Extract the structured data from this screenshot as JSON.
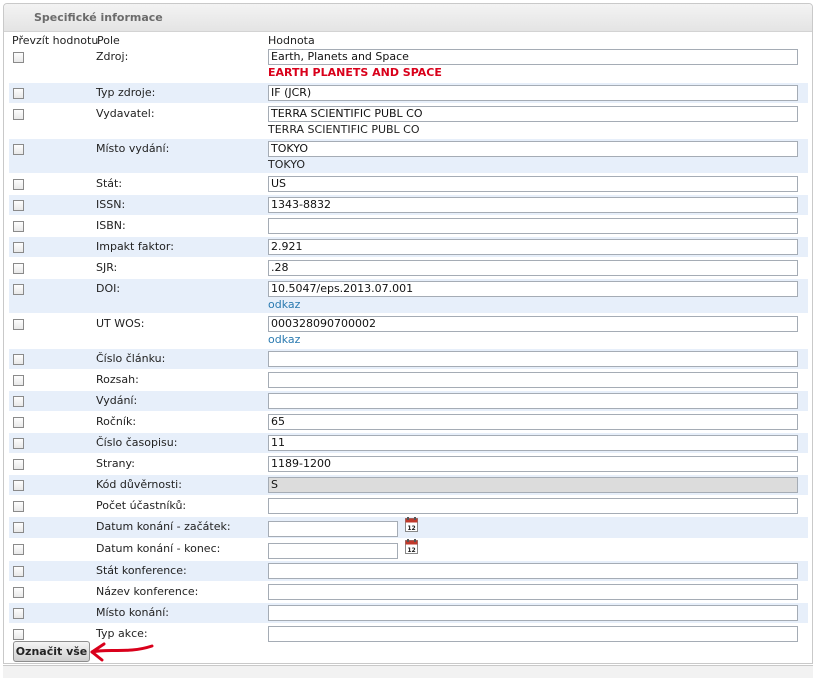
{
  "panel": {
    "title": "Specifické informace"
  },
  "columns": {
    "take": "Převzít hodnotu",
    "field": "Pole",
    "value": "Hodnota"
  },
  "rows": [
    {
      "label": "Zdroj:",
      "value": "Earth, Planets and Space",
      "sub": "EARTH PLANETS AND SPACE",
      "sub_style": "red"
    },
    {
      "label": "Typ zdroje:",
      "value": "IF (JCR)"
    },
    {
      "label": "Vydavatel:",
      "value": "TERRA SCIENTIFIC PUBL CO",
      "sub": "TERRA SCIENTIFIC PUBL CO",
      "sub_style": "plain"
    },
    {
      "label": "Místo vydání:",
      "value": "TOKYO",
      "sub": "TOKYO",
      "sub_style": "plain"
    },
    {
      "label": "Stát:",
      "value": "US"
    },
    {
      "label": "ISSN:",
      "value": "1343-8832"
    },
    {
      "label": "ISBN:",
      "value": ""
    },
    {
      "label": "Impakt faktor:",
      "value": "2.921"
    },
    {
      "label": "SJR:",
      "value": ".28"
    },
    {
      "label": "DOI:",
      "value": "10.5047/eps.2013.07.001",
      "sub": "odkaz",
      "sub_style": "link"
    },
    {
      "label": "UT WOS:",
      "value": "000328090700002",
      "sub": "odkaz",
      "sub_style": "link"
    },
    {
      "label": "Číslo článku:",
      "value": ""
    },
    {
      "label": "Rozsah:",
      "value": ""
    },
    {
      "label": "Vydání:",
      "value": ""
    },
    {
      "label": "Ročník:",
      "value": "65"
    },
    {
      "label": "Číslo časopisu:",
      "value": "11"
    },
    {
      "label": "Strany:",
      "value": "1189-1200"
    },
    {
      "label": "Kód důvěrnosti:",
      "value": "S",
      "disabled": true
    },
    {
      "label": "Počet účastníků:",
      "value": ""
    },
    {
      "label": "Datum konání - začátek:",
      "value": "",
      "date": true
    },
    {
      "label": "Datum konání - konec:",
      "value": "",
      "date": true
    },
    {
      "label": "Stát konference:",
      "value": ""
    },
    {
      "label": "Název konference:",
      "value": ""
    },
    {
      "label": "Místo konání:",
      "value": ""
    },
    {
      "label": "Typ akce:",
      "value": ""
    }
  ],
  "calendar_icon_text": "12",
  "select_all_button": "Označit vše",
  "colors": {
    "row_alt": "#e7effa",
    "arrow": "#d9001b",
    "link": "#2a7ab0",
    "source_red": "#d9001b"
  }
}
